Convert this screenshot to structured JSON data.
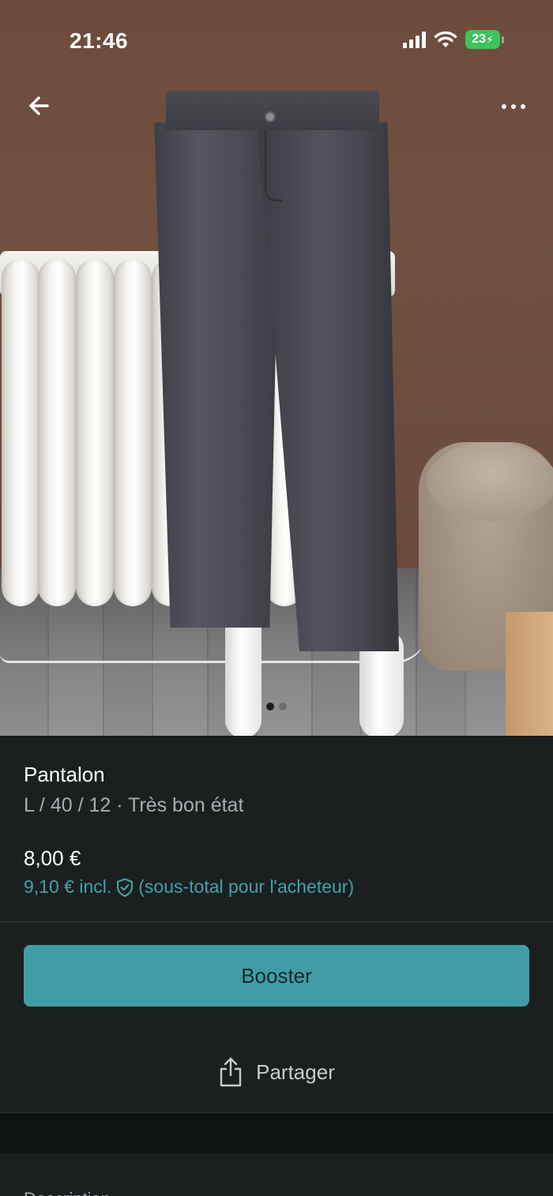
{
  "status_bar": {
    "time": "21:46",
    "battery": "23",
    "battery_color": "#3ec45a",
    "icons": [
      "cellular-signal-icon",
      "wifi-icon",
      "battery-charging-icon"
    ]
  },
  "nav": {
    "back_icon": "arrow-left-icon",
    "more_icon": "more-horizontal-icon"
  },
  "gallery": {
    "photo_count": 2,
    "active_index": 0
  },
  "item": {
    "title": "Pantalon",
    "details": "L / 40 / 12 · Très bon état",
    "price": "8,00 €",
    "price_incl": "9,10 € incl.",
    "price_incl_note": "(sous-total pour l'acheteur)",
    "protection_icon": "shield-check-icon"
  },
  "actions": {
    "booster_label": "Booster",
    "share_label": "Partager",
    "share_icon": "share-icon"
  },
  "description": {
    "label": "Description"
  },
  "colors": {
    "background": "#1b1f20",
    "accent": "#419ca6",
    "accent_text": "#3fa3a8",
    "muted_text": "#a9adaf"
  }
}
